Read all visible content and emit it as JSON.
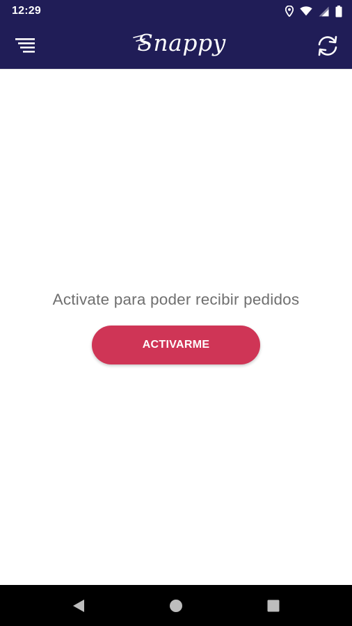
{
  "status_bar": {
    "time": "12:29",
    "icons": [
      "location-icon",
      "wifi-icon",
      "signal-icon",
      "battery-icon"
    ]
  },
  "app_bar": {
    "title": "Snappy",
    "menu_icon": "menu-icon",
    "refresh_icon": "refresh-icon",
    "background_color": "#201d57"
  },
  "main": {
    "message": "Activate para poder recibir pedidos",
    "button_label": "ACTIVARME",
    "button_color": "#cf3556"
  },
  "nav_bar": {
    "buttons": [
      "back-icon",
      "home-icon",
      "recent-apps-icon"
    ]
  }
}
